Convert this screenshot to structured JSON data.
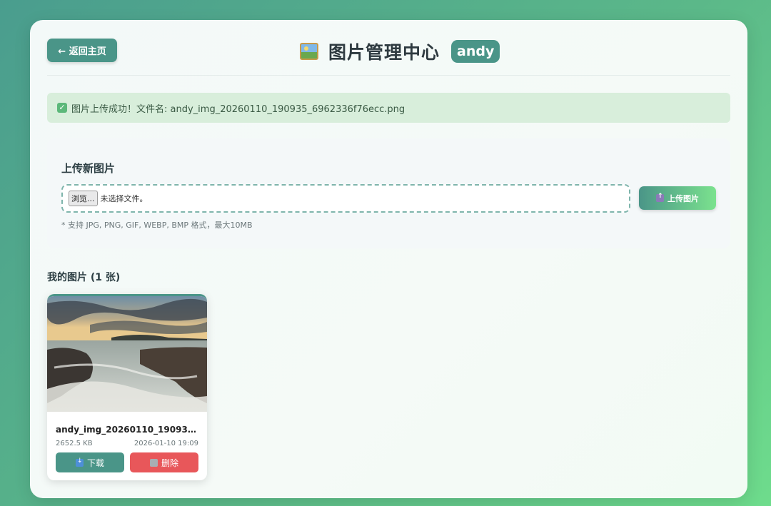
{
  "header": {
    "back_label": "← 返回主页",
    "title_icon": "framed-picture-icon",
    "title": "图片管理中心",
    "username": "andy",
    "accent_color": "#4a9588"
  },
  "alert": {
    "icon": "check-icon",
    "message": "图片上传成功！文件名: andy_img_20260110_190935_6962336f76ecc.png",
    "bg_color": "#d8eedb"
  },
  "upload": {
    "title": "上传新图片",
    "browse_label": "浏览...",
    "no_file_text": "未选择文件。",
    "button_icon": "upload-icon",
    "button_label": "上传图片",
    "hint": "* 支持 JPG, PNG, GIF, WEBP, BMP 格式，最大10MB"
  },
  "gallery": {
    "title": "我的图片 (1 张)",
    "images": [
      {
        "file_name": "andy_img_20260110_190935_6962336f76ecc.png",
        "size": "2652.5 KB",
        "date": "2026-01-10 19:09",
        "download_label": "下载",
        "delete_label": "删除",
        "delete_color": "#e8575a"
      }
    ]
  }
}
